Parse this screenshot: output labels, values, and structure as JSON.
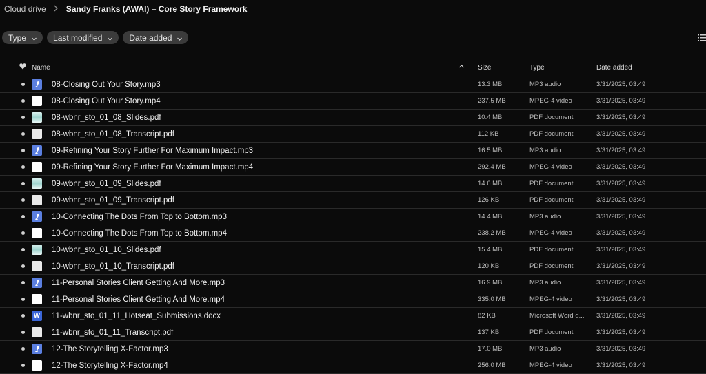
{
  "breadcrumb": {
    "root": "Cloud drive",
    "current": "Sandy Franks (AWAI) – Core Story Framework"
  },
  "filters": [
    {
      "label": "Type"
    },
    {
      "label": "Last modified"
    },
    {
      "label": "Date added"
    }
  ],
  "columns": {
    "name": "Name",
    "size": "Size",
    "type": "Type",
    "date_added": "Date added"
  },
  "rows": [
    {
      "name": "08-Closing Out Your Story.mp3",
      "size": "13.3 MB",
      "type": "MP3 audio",
      "date": "3/31/2025, 03:49",
      "icon": "audio-file-icon"
    },
    {
      "name": "08-Closing Out Your Story.mp4",
      "size": "237.5 MB",
      "type": "MPEG-4 video",
      "date": "3/31/2025, 03:49",
      "icon": "video-file-icon"
    },
    {
      "name": "08-wbnr_sto_01_08_Slides.pdf",
      "size": "10.4 MB",
      "type": "PDF document",
      "date": "3/31/2025, 03:49",
      "icon": "pdf-slides-icon"
    },
    {
      "name": "08-wbnr_sto_01_08_Transcript.pdf",
      "size": "112 KB",
      "type": "PDF document",
      "date": "3/31/2025, 03:49",
      "icon": "pdf-file-icon"
    },
    {
      "name": "09-Refining Your Story Further For Maximum Impact.mp3",
      "size": "16.5 MB",
      "type": "MP3 audio",
      "date": "3/31/2025, 03:49",
      "icon": "audio-file-icon"
    },
    {
      "name": "09-Refining Your Story Further For Maximum Impact.mp4",
      "size": "292.4 MB",
      "type": "MPEG-4 video",
      "date": "3/31/2025, 03:49",
      "icon": "video-file-icon"
    },
    {
      "name": "09-wbnr_sto_01_09_Slides.pdf",
      "size": "14.6 MB",
      "type": "PDF document",
      "date": "3/31/2025, 03:49",
      "icon": "pdf-slides-icon"
    },
    {
      "name": "09-wbnr_sto_01_09_Transcript.pdf",
      "size": "126 KB",
      "type": "PDF document",
      "date": "3/31/2025, 03:49",
      "icon": "pdf-file-icon"
    },
    {
      "name": "10-Connecting The Dots From Top to Bottom.mp3",
      "size": "14.4 MB",
      "type": "MP3 audio",
      "date": "3/31/2025, 03:49",
      "icon": "audio-file-icon"
    },
    {
      "name": "10-Connecting The Dots From Top to Bottom.mp4",
      "size": "238.2 MB",
      "type": "MPEG-4 video",
      "date": "3/31/2025, 03:49",
      "icon": "video-file-icon"
    },
    {
      "name": "10-wbnr_sto_01_10_Slides.pdf",
      "size": "15.4 MB",
      "type": "PDF document",
      "date": "3/31/2025, 03:49",
      "icon": "pdf-slides-icon"
    },
    {
      "name": "10-wbnr_sto_01_10_Transcript.pdf",
      "size": "120 KB",
      "type": "PDF document",
      "date": "3/31/2025, 03:49",
      "icon": "pdf-file-icon"
    },
    {
      "name": "11-Personal Stories Client Getting And More.mp3",
      "size": "16.9 MB",
      "type": "MP3 audio",
      "date": "3/31/2025, 03:49",
      "icon": "audio-file-icon"
    },
    {
      "name": "11-Personal Stories Client Getting And More.mp4",
      "size": "335.0 MB",
      "type": "MPEG-4 video",
      "date": "3/31/2025, 03:49",
      "icon": "video-file-icon"
    },
    {
      "name": "11-wbnr_sto_01_11_Hotseat_Submissions.docx",
      "size": "82 KB",
      "type": "Microsoft Word d...",
      "date": "3/31/2025, 03:49",
      "icon": "word-doc-icon"
    },
    {
      "name": "11-wbnr_sto_01_11_Transcript.pdf",
      "size": "137 KB",
      "type": "PDF document",
      "date": "3/31/2025, 03:49",
      "icon": "pdf-file-icon"
    },
    {
      "name": "12-The Storytelling X-Factor.mp3",
      "size": "17.0 MB",
      "type": "MP3 audio",
      "date": "3/31/2025, 03:49",
      "icon": "audio-file-icon"
    },
    {
      "name": "12-The Storytelling X-Factor.mp4",
      "size": "256.0 MB",
      "type": "MPEG-4 video",
      "date": "3/31/2025, 03:49",
      "icon": "video-file-icon"
    }
  ],
  "icons": {
    "favorite_header": "heart-icon",
    "sort": "chevron-up-icon",
    "filter_chevron": "chevron-down-icon",
    "view_toggle": "list-view-icon",
    "separator": "chevron-right-icon"
  },
  "colors": {
    "background": "#0b0b0b",
    "chip": "#3b3b3b",
    "audio_icon": "#5b7fe0",
    "word_icon": "#3b66d8"
  }
}
